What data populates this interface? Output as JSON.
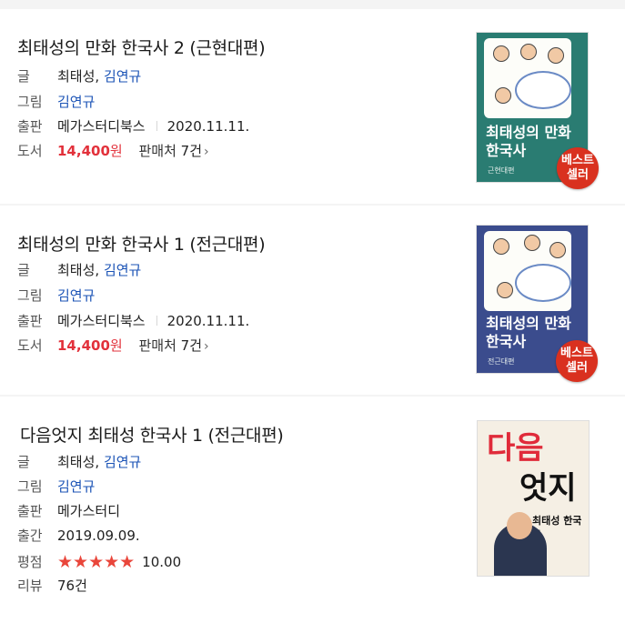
{
  "labels": {
    "author": "글",
    "illustrator": "그림",
    "publisher": "출판",
    "format": "도서",
    "published": "출간",
    "rating": "평점",
    "review": "리뷰",
    "sellers_suffix": "판매처",
    "won": "원",
    "chevron": "›"
  },
  "books": [
    {
      "title": "최태성의 만화 한국사 2 (근현대편)",
      "author_main": "최태성,",
      "author_link": "김연규",
      "illustrator": "김연규",
      "publisher": "메가스터디북스",
      "date": "2020.11.11.",
      "price": "14,400",
      "sellers": "7건",
      "cover_title": "최태성의 만화 한국사",
      "cover_tag": "근현대편",
      "badge": "베스트 셀러",
      "cover_color": "#2a7c72"
    },
    {
      "title": "최태성의 만화 한국사 1 (전근대편)",
      "author_main": "최태성,",
      "author_link": "김연규",
      "illustrator": "김연규",
      "publisher": "메가스터디북스",
      "date": "2020.11.11.",
      "price": "14,400",
      "sellers": "7건",
      "cover_title": "최태성의 만화 한국사",
      "cover_tag": "전근대편",
      "badge": "베스트 셀러",
      "cover_color": "#3b4c8d"
    },
    {
      "title": "다음엇지 최태성 한국사 1 (전근대편)",
      "author_main": "최태성,",
      "author_link": "김연규",
      "illustrator": "김연규",
      "publisher": "메가스터디",
      "date": "2019.09.09.",
      "stars": "★★★★★",
      "rating_value": "10.00",
      "reviews": "76건",
      "cover_line1": "다음",
      "cover_line2": "엇지",
      "cover_subtitle": "최태성 한국사",
      "cover_color": "#f5efe4"
    }
  ],
  "colors": {
    "price_red": "#e2313b",
    "link_blue": "#1b53b6",
    "star_red": "#e9463b",
    "badge_red": "#d9311f"
  }
}
